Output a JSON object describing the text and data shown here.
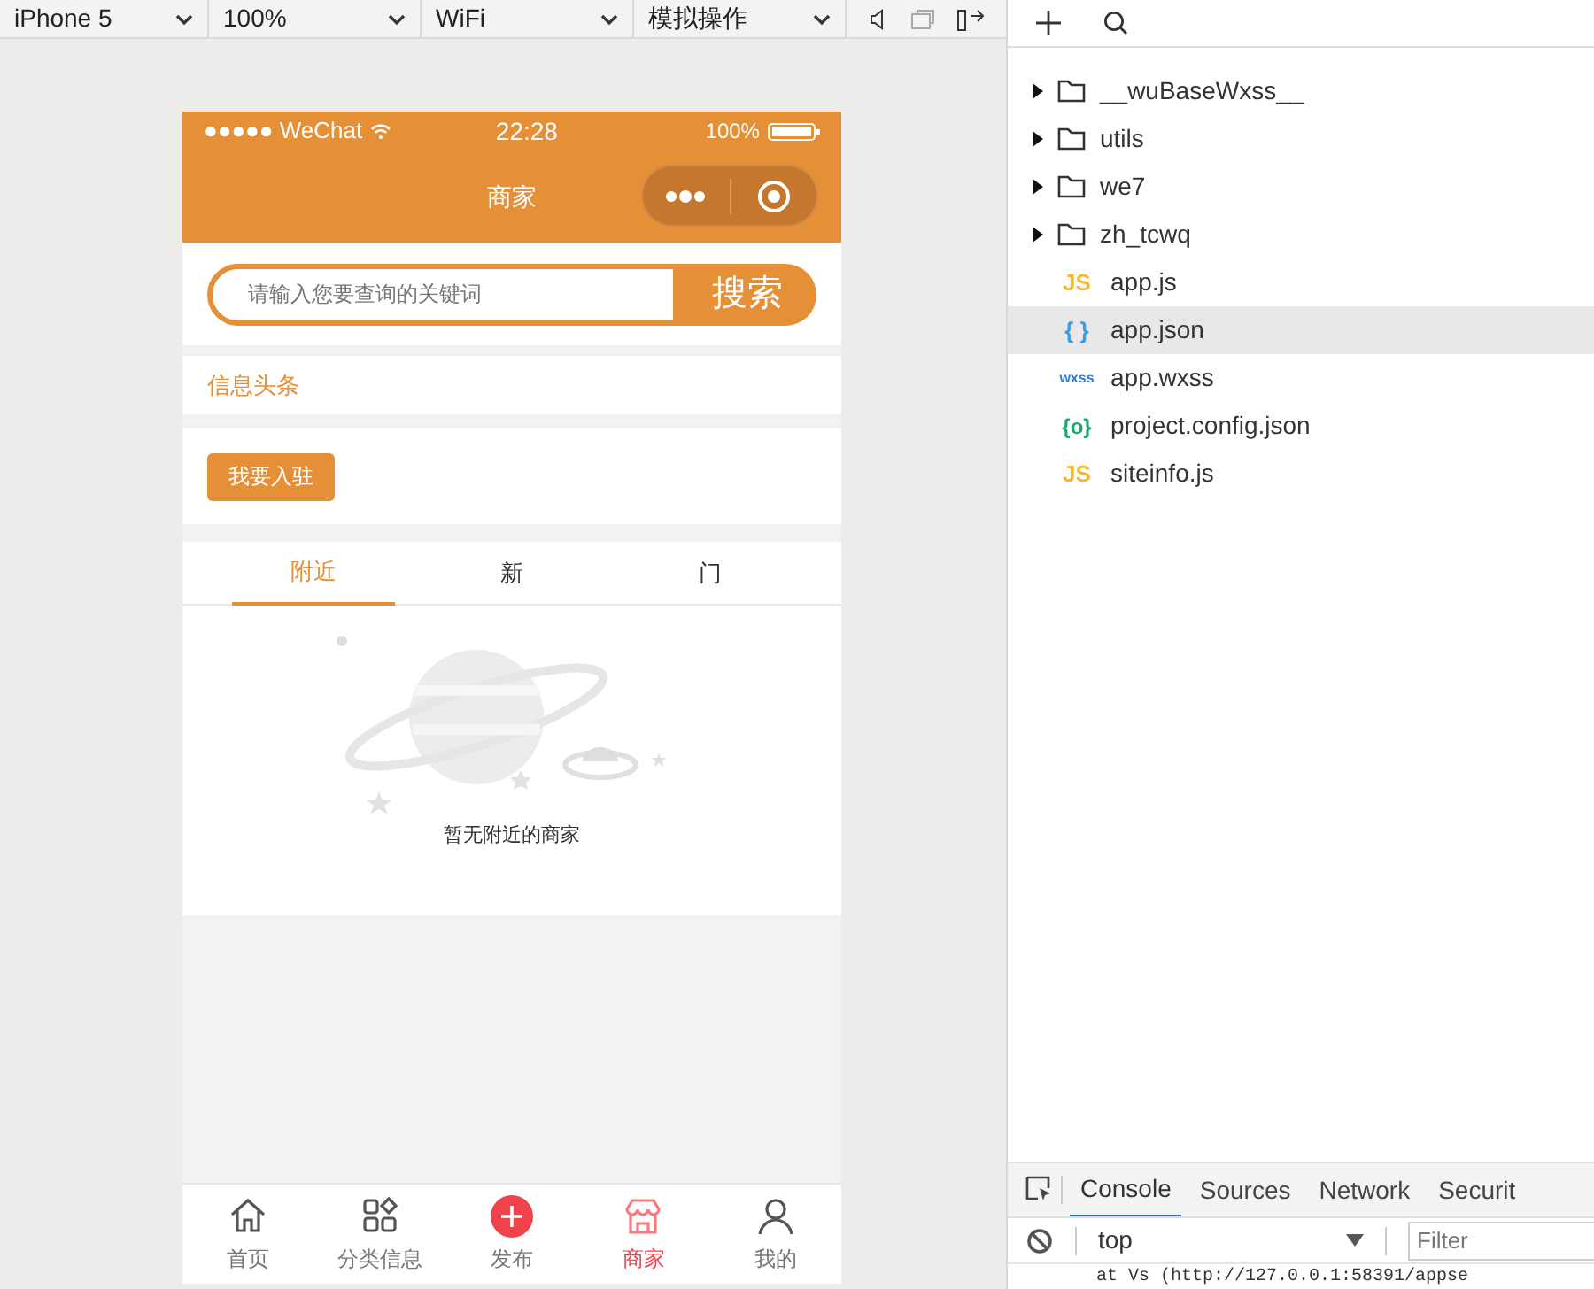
{
  "toolbar": {
    "device": "iPhone 5",
    "zoom": "100%",
    "network": "WiFi",
    "operation": "模拟操作"
  },
  "phone": {
    "status_bar": {
      "carrier": "●●●●● WeChat",
      "time": "22:28",
      "battery": "100%"
    },
    "title": "商家",
    "search": {
      "placeholder": "请输入您要查询的关键词",
      "button": "搜索"
    },
    "headline": "信息头条",
    "join_button": "我要入驻",
    "tabs": [
      {
        "label": "附近",
        "selected": true
      },
      {
        "label": "新",
        "selected": false
      },
      {
        "label": "门",
        "selected": false
      }
    ],
    "empty_text": "暂无附近的商家",
    "tabbar": [
      {
        "label": "首页",
        "kind": "home",
        "selected": false
      },
      {
        "label": "分类信息",
        "kind": "grid",
        "selected": false
      },
      {
        "label": "发布",
        "kind": "plus",
        "selected": false
      },
      {
        "label": "商家",
        "kind": "shop",
        "selected": true
      },
      {
        "label": "我的",
        "kind": "person",
        "selected": false
      }
    ]
  },
  "file_tree": [
    {
      "name": "__wuBaseWxss__",
      "kind": "folder",
      "selected": false
    },
    {
      "name": "utils",
      "kind": "folder",
      "selected": false
    },
    {
      "name": "we7",
      "kind": "folder",
      "selected": false
    },
    {
      "name": "zh_tcwq",
      "kind": "folder",
      "selected": false
    },
    {
      "name": "app.js",
      "kind": "js",
      "badge": "JS",
      "selected": false
    },
    {
      "name": "app.json",
      "kind": "json",
      "badge": "{ }",
      "selected": true
    },
    {
      "name": "app.wxss",
      "kind": "wxss",
      "badge": "wxss",
      "selected": false
    },
    {
      "name": "project.config.json",
      "kind": "config",
      "badge": "{o}",
      "selected": false
    },
    {
      "name": "siteinfo.js",
      "kind": "js",
      "badge": "JS",
      "selected": false
    }
  ],
  "devtools": {
    "tabs": [
      {
        "label": "Console",
        "selected": true
      },
      {
        "label": "Sources",
        "selected": false
      },
      {
        "label": "Network",
        "selected": false
      },
      {
        "label": "Securit",
        "selected": false
      }
    ],
    "context": "top",
    "filter_placeholder": "Filter",
    "console_line": "at Vs (http://127.0.0.1:58391/appse"
  }
}
